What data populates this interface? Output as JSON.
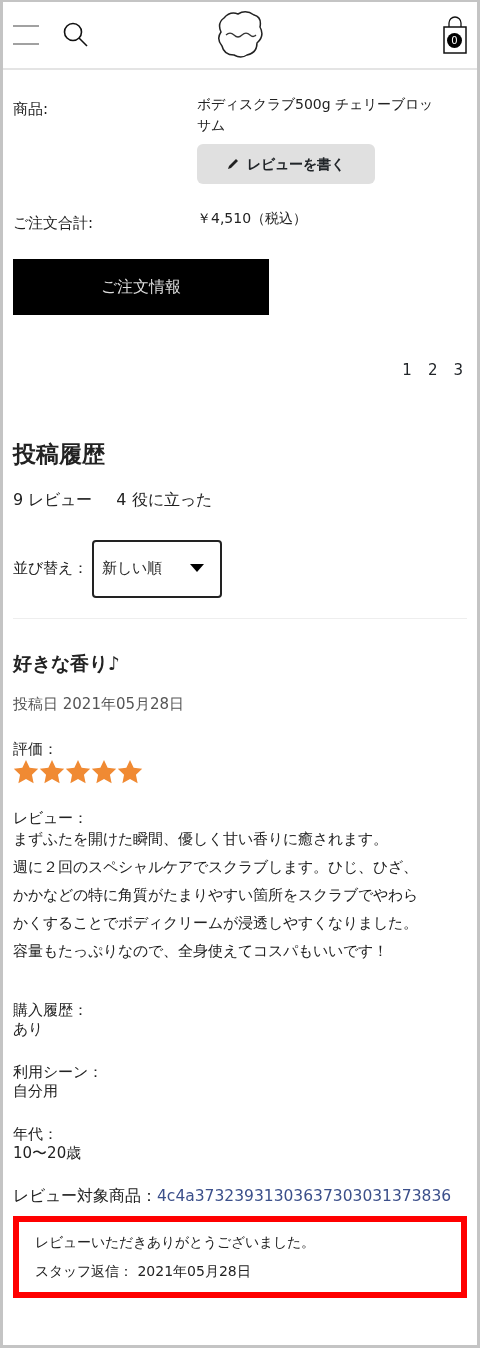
{
  "header": {
    "cart_count": "0"
  },
  "order": {
    "rows": [
      {
        "label": "商品:",
        "value": "ボディスクラブ500g チェリーブロッサム",
        "action": "レビューを書く"
      },
      {
        "label": "ご注文合計:",
        "value": "￥4,510（税込）"
      }
    ],
    "info_button": "ご注文情報"
  },
  "pagination": [
    "1",
    "2",
    "3"
  ],
  "history": {
    "title": "投稿履歴",
    "reviews_count": "9 レビュー",
    "helpful_count": "4 役に立った",
    "sort_label": "並び替え：",
    "sort_value": "新しい順"
  },
  "review": {
    "title": "好きな香り♪",
    "posted": "投稿日 2021年05月28日",
    "rating_label": "評価：",
    "stars": 5,
    "body_label": "レビュー：",
    "body_lines": [
      "まずふたを開けた瞬間、優しく甘い香りに癒されます。",
      "週に２回のスペシャルケアでスクラブします。ひじ、ひざ、",
      "かかなどの特に角質がたまりやすい箇所をスクラブでやわら",
      "かくすることでボディクリームが浸透しやすくなりました。",
      "容量もたっぷりなので、全身使えてコスパもいいです！"
    ],
    "fields": [
      {
        "label": "購入履歴：",
        "value": "あり"
      },
      {
        "label": "利用シーン：",
        "value": "自分用"
      },
      {
        "label": "年代：",
        "value": "10〜20歳"
      }
    ],
    "target_label": "レビュー対象商品：",
    "target_link": "4c4a37323931303637303031373836",
    "reply": {
      "text": "レビューいただきありがとうございました。",
      "meta": "スタッフ返信： 2021年05月28日"
    }
  }
}
